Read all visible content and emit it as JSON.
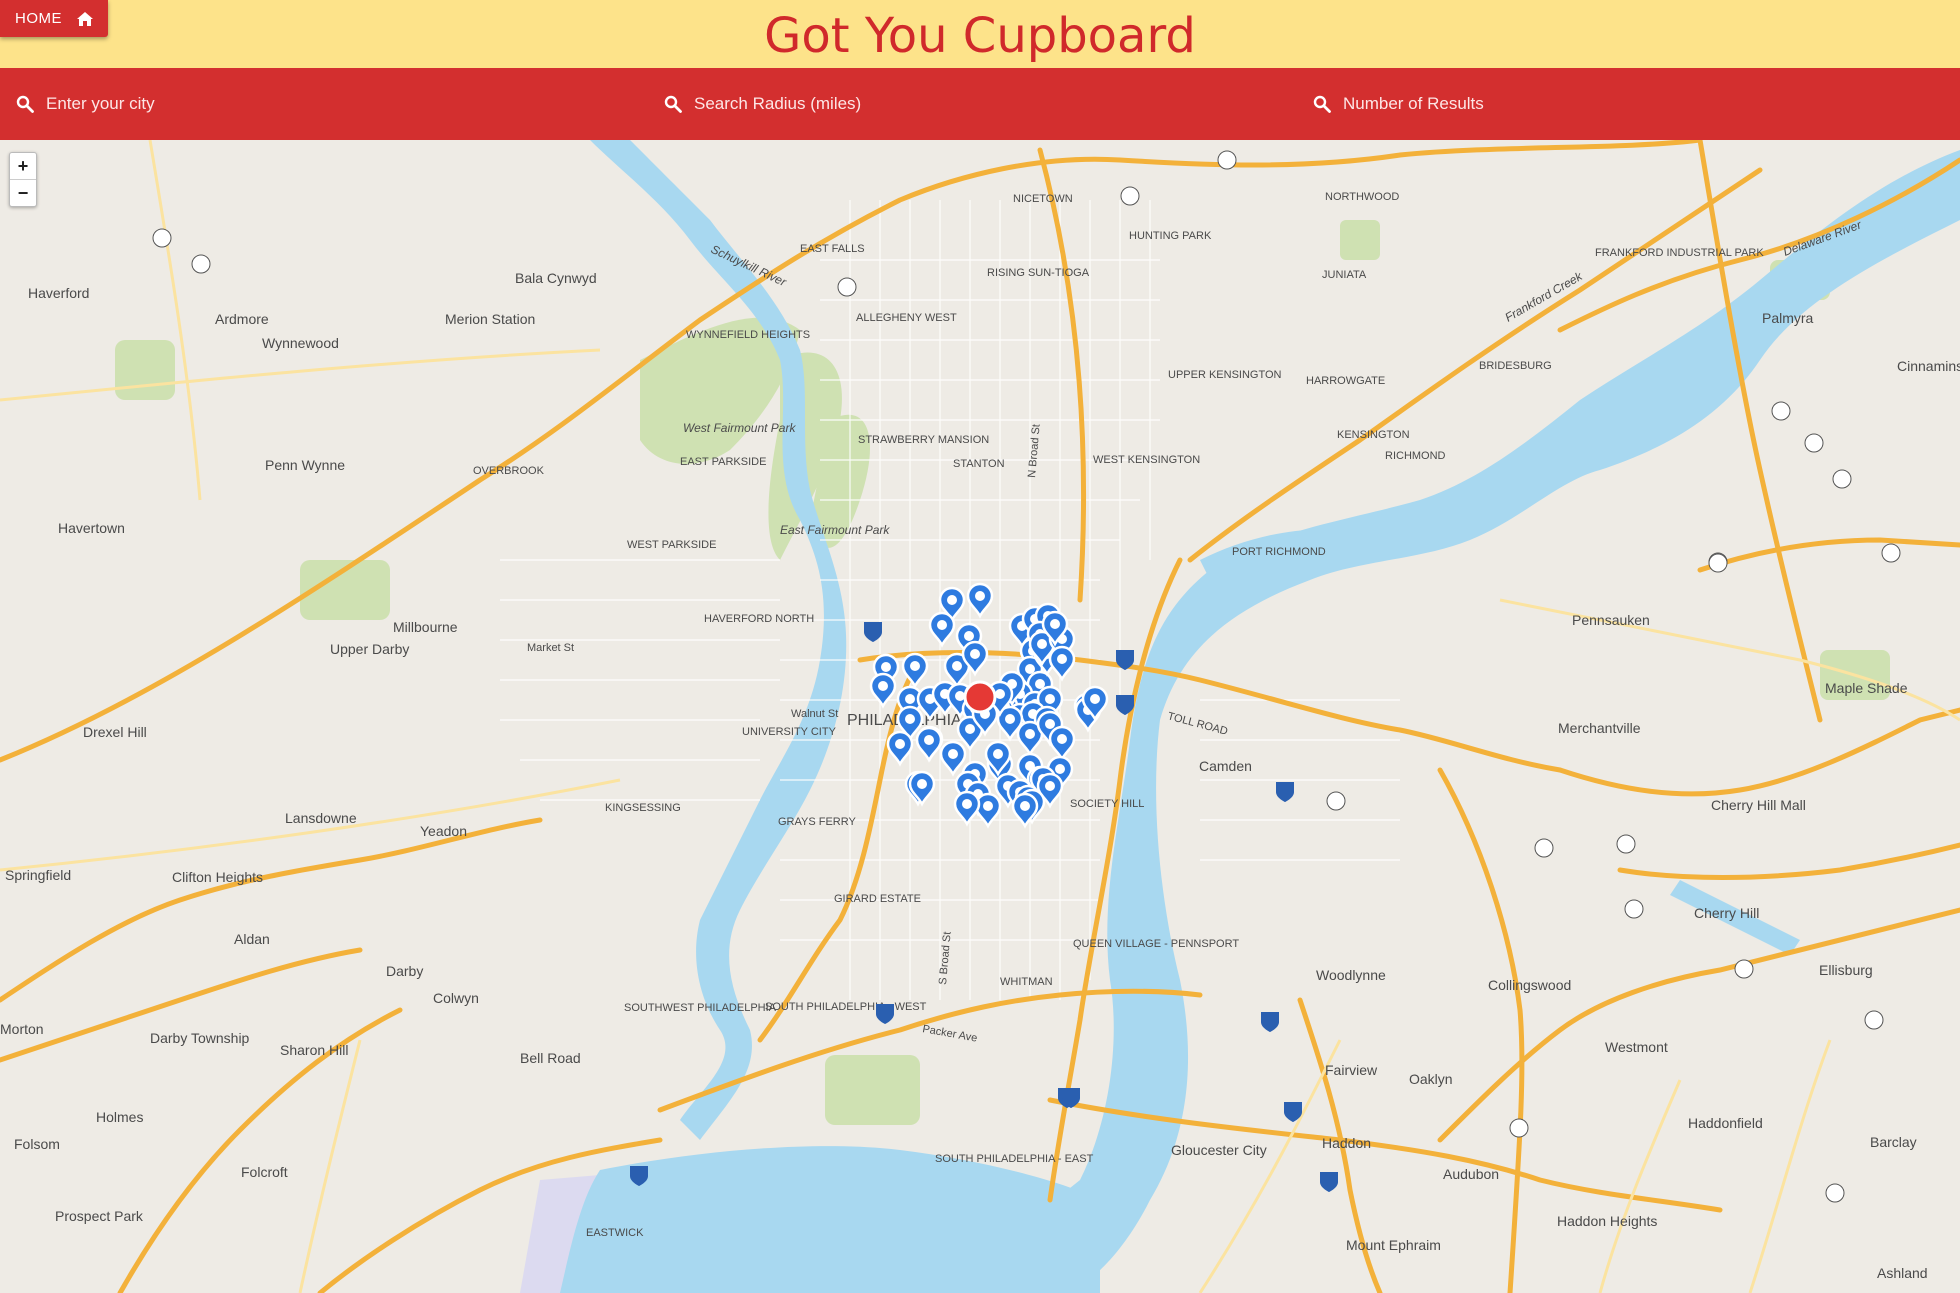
{
  "header": {
    "title": "Got You Cupboard",
    "home_label": "HOME"
  },
  "search": {
    "city_placeholder": "Enter your city",
    "radius_placeholder": "Search Radius (miles)",
    "results_placeholder": "Number of Results"
  },
  "map": {
    "zoom_in": "+",
    "zoom_out": "−",
    "colors": {
      "marker": "#2e7be0",
      "center_marker": "#e53935",
      "header": "#fde38a",
      "bar": "#d32f2f"
    },
    "place_labels": [
      "Bala Cynwyd",
      "Haverford",
      "Ardmore",
      "Wynnewood",
      "Merion Station",
      "Penn Wynne",
      "Havertown",
      "Millbourne",
      "Upper Darby",
      "Drexel Hill",
      "Lansdowne",
      "Yeadon",
      "Springfield",
      "Clifton Heights",
      "Aldan",
      "Darby",
      "Colwyn",
      "Sharon Hill",
      "Darby Township",
      "Morton",
      "Holmes",
      "Folsom",
      "Folcroft",
      "Prospect Park",
      "Bell Road",
      "Camden",
      "Pennsauken",
      "Merchantville",
      "Maple Shade",
      "Palmyra",
      "Cinnaminson",
      "Cherry Hill Mall",
      "Cherry Hill",
      "Ellisburg",
      "Collingswood",
      "Woodlynne",
      "Fairview",
      "Oaklyn",
      "Westmont",
      "Haddonfield",
      "Barclay",
      "Haddon",
      "Audubon",
      "Gloucester City",
      "Haddon Heights",
      "Mount Ephraim",
      "Ashland",
      "PHILADELPHIA",
      "KENSINGTON",
      "RICHMOND",
      "STANTON",
      "WEST KENSINGTON",
      "NICETOWN",
      "HUNTING PARK",
      "NORTHWOOD",
      "JUNIATA",
      "FRANKFORD INDUSTRIAL PARK",
      "BRIDESBURG",
      "HARROWGATE",
      "UPPER KENSINGTON",
      "PORT RICHMOND",
      "KINGSESSING",
      "GRAYS FERRY",
      "SOCIETY HILL",
      "QUEEN VILLAGE - PENNSPORT",
      "WHITMAN",
      "SOUTHWEST PHILADELPHIA",
      "SOUTH PHILADELPHIA - WEST",
      "SOUTH PHILADELPHIA - EAST",
      "GIRARD ESTATE",
      "EASTWICK",
      "HAVERFORD NORTH",
      "WEST PARKSIDE",
      "OVERBROOK",
      "WYNNEFIELD HEIGHTS",
      "EAST FALLS",
      "ALLEGHENY WEST",
      "STRAWBERRY MANSION",
      "EAST PARKSIDE",
      "UNIVERSITY CITY",
      "RISING SUN-TIOGA",
      "West Fairmount Park",
      "East Fairmount Park",
      "Schuylkill River",
      "Delaware River",
      "Frankford Creek",
      "Walnut St",
      "Market St",
      "Packer Ave",
      "TOLL ROAD",
      "N Broad St",
      "S Broad St"
    ]
  }
}
